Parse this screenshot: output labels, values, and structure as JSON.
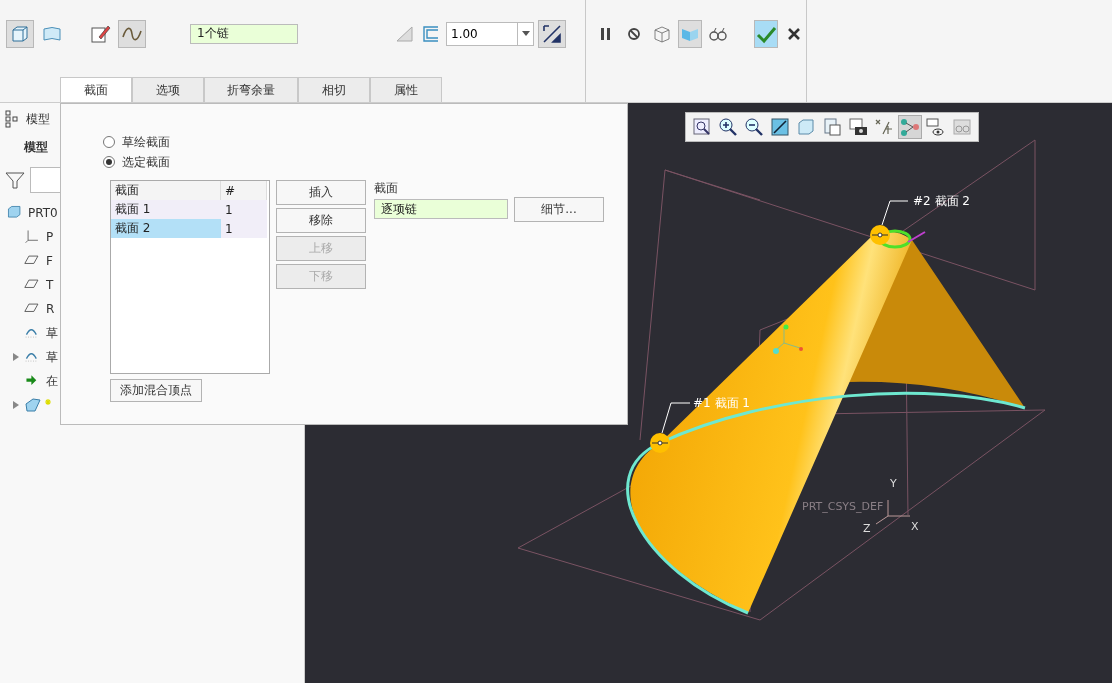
{
  "ribbon": {
    "shape_tools": [
      {
        "selected": true
      },
      {
        "selected": false
      }
    ],
    "chain_tools": [
      {
        "selected": false
      },
      {
        "selected": true
      }
    ],
    "chain_field": {
      "value": "1个链"
    },
    "thickness_field": {
      "value": "1.00"
    },
    "control_tools": [
      {
        "selected": false
      },
      {
        "selected": false
      },
      {
        "selected": false
      },
      {
        "selected": true
      },
      {
        "selected": false
      }
    ],
    "tabs": [
      {
        "label": "截面",
        "selected": true
      },
      {
        "label": "选项",
        "selected": false
      },
      {
        "label": "折弯余量",
        "selected": false
      },
      {
        "label": "相切",
        "selected": false
      },
      {
        "label": "属性",
        "selected": false
      }
    ]
  },
  "model_tree": {
    "title": "模型",
    "subtitle": "模型",
    "items": [
      {
        "label": "PRT0",
        "kind": "part",
        "expandable": false
      },
      {
        "label": "P",
        "kind": "csys",
        "expandable": false
      },
      {
        "label": "F",
        "kind": "plane",
        "expandable": false
      },
      {
        "label": "T",
        "kind": "plane",
        "expandable": false
      },
      {
        "label": "R",
        "kind": "plane",
        "expandable": false
      },
      {
        "label": "草",
        "kind": "sketch",
        "expandable": false
      },
      {
        "label": "草",
        "kind": "sketch",
        "expandable": true
      },
      {
        "label": "在",
        "kind": "insert",
        "expandable": false
      },
      {
        "kind": "feature",
        "expandable": true
      }
    ]
  },
  "dialog": {
    "modes": [
      {
        "label": "草绘截面",
        "selected": false
      },
      {
        "label": "选定截面",
        "selected": true
      }
    ],
    "table": {
      "columns": [
        "截面",
        "#"
      ],
      "rows": [
        {
          "cells": [
            "截面 1",
            "1"
          ],
          "selected": false
        },
        {
          "cells": [
            "截面 2",
            "1"
          ],
          "selected": true
        }
      ]
    },
    "buttons": [
      {
        "label": "插入",
        "disabled": false
      },
      {
        "label": "移除",
        "disabled": false
      },
      {
        "label": "上移",
        "disabled": true
      },
      {
        "label": "下移",
        "disabled": true
      }
    ],
    "section_label": "截面",
    "section_field": {
      "value": "逐项链"
    },
    "details_button": "细节...",
    "add_vertex_button": "添加混合顶点"
  },
  "viewport": {
    "view_tools": [
      {
        "selected": false
      },
      {
        "selected": false
      },
      {
        "selected": false
      },
      {
        "selected": false
      },
      {
        "selected": false
      },
      {
        "selected": false
      },
      {
        "selected": false
      },
      {
        "selected": false
      },
      {
        "selected": true
      },
      {
        "selected": false
      },
      {
        "selected": false
      }
    ],
    "labels": {
      "section_2": "#2 截面 2",
      "section_1": "#1 截面 1",
      "csys": "PRT_CSYS_DEF",
      "axis_y": "Y",
      "axis_z": "Z",
      "axis_x": "X"
    }
  }
}
